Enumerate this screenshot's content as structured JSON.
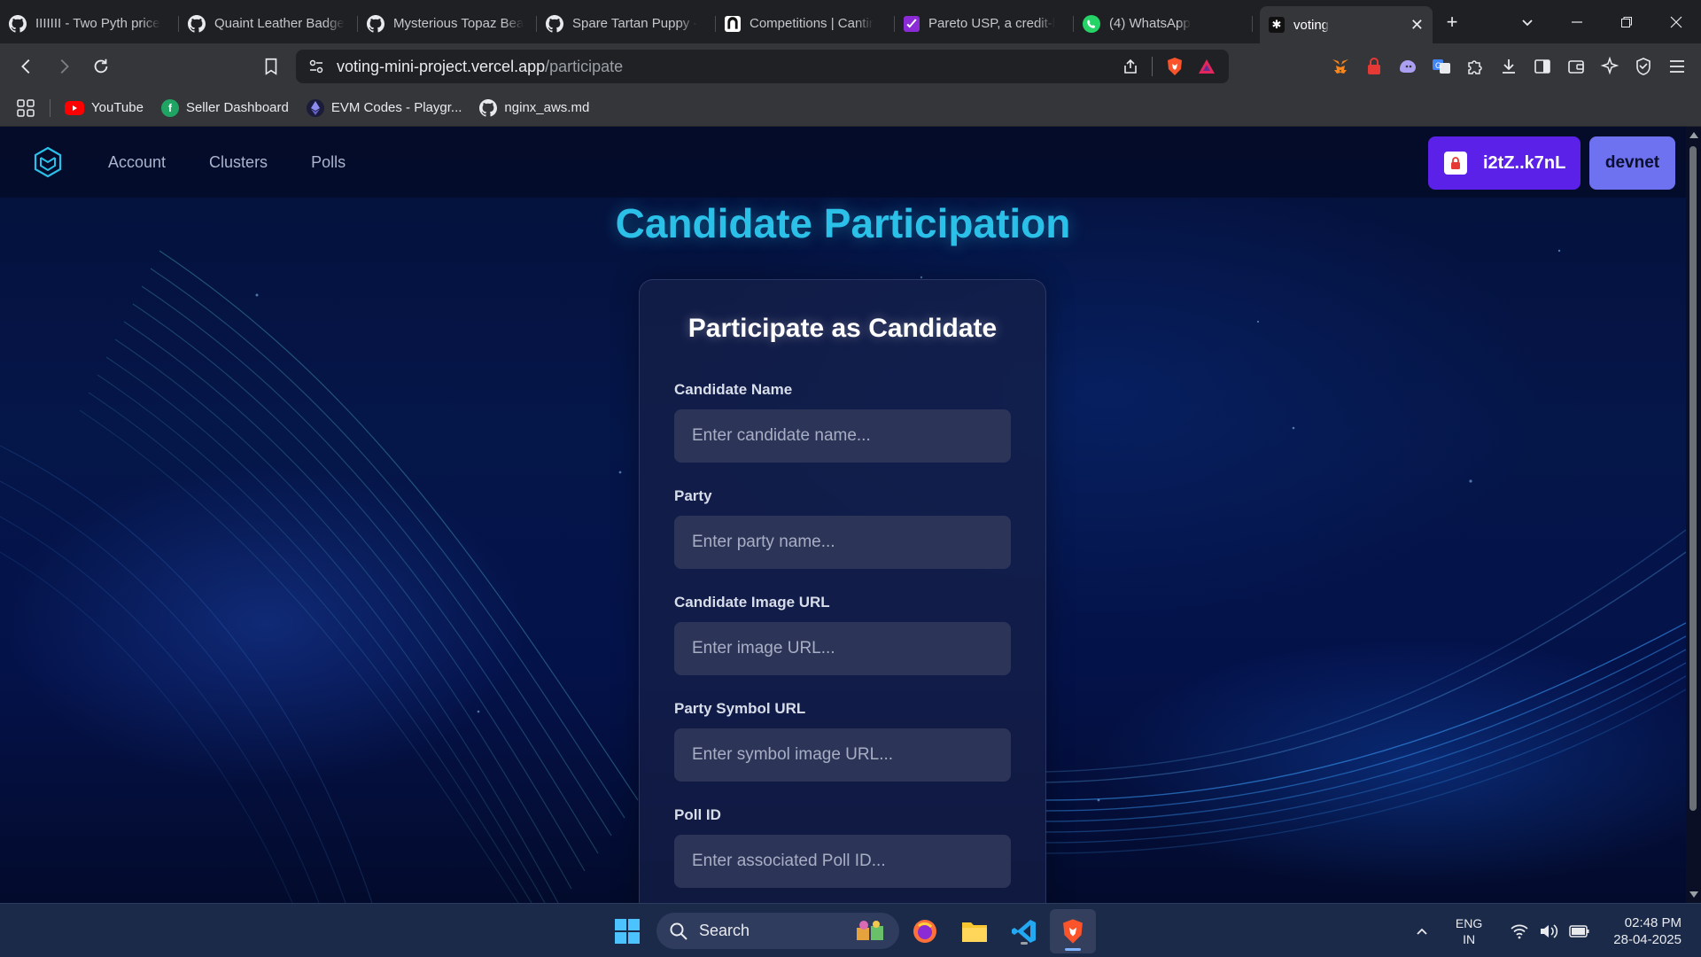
{
  "browser": {
    "tabs": [
      {
        "title": "IIIIIII - Two Pyth price",
        "icon": "github-icon"
      },
      {
        "title": "Quaint Leather Badge",
        "icon": "github-icon"
      },
      {
        "title": "Mysterious Topaz Bea",
        "icon": "github-icon"
      },
      {
        "title": "Spare Tartan Puppy -",
        "icon": "github-icon"
      },
      {
        "title": "Competitions | Cantir",
        "icon": "cantina-icon"
      },
      {
        "title": "Pareto USP, a credit-l",
        "icon": "pareto-icon"
      },
      {
        "title": "(4) WhatsApp",
        "icon": "whatsapp-icon"
      }
    ],
    "active_tab": {
      "title": "voting",
      "close": "✕"
    },
    "new_tab": "+",
    "url_host": "voting-mini-project.vercel.app",
    "url_path": "/participate",
    "bookmarks": [
      {
        "label": "YouTube",
        "icon": "youtube-icon",
        "color": "#ff0000"
      },
      {
        "label": "Seller Dashboard",
        "icon": "seller-dashboard-icon",
        "color": "#1fa463"
      },
      {
        "label": "EVM Codes - Playgr...",
        "icon": "ethereum-icon",
        "color": "#3c3c6e"
      },
      {
        "label": "nginx_aws.md",
        "icon": "github-icon",
        "color": "#ffffff"
      }
    ]
  },
  "app": {
    "nav": {
      "links": [
        "Account",
        "Clusters",
        "Polls"
      ]
    },
    "wallet_label": "i2tZ..k7nL",
    "cluster_label": "devnet",
    "accent_color": "#5b21e8",
    "title": "Candidate Participation",
    "form": {
      "heading": "Participate as Candidate",
      "fields": [
        {
          "label": "Candidate Name",
          "placeholder": "Enter candidate name..."
        },
        {
          "label": "Party",
          "placeholder": "Enter party name..."
        },
        {
          "label": "Candidate Image URL",
          "placeholder": "Enter image URL..."
        },
        {
          "label": "Party Symbol URL",
          "placeholder": "Enter symbol image URL..."
        },
        {
          "label": "Poll ID",
          "placeholder": "Enter associated Poll ID..."
        }
      ]
    }
  },
  "taskbar": {
    "search_label": "Search",
    "lang_top": "ENG",
    "lang_bottom": "IN",
    "time": "02:48 PM",
    "date": "28-04-2025"
  }
}
